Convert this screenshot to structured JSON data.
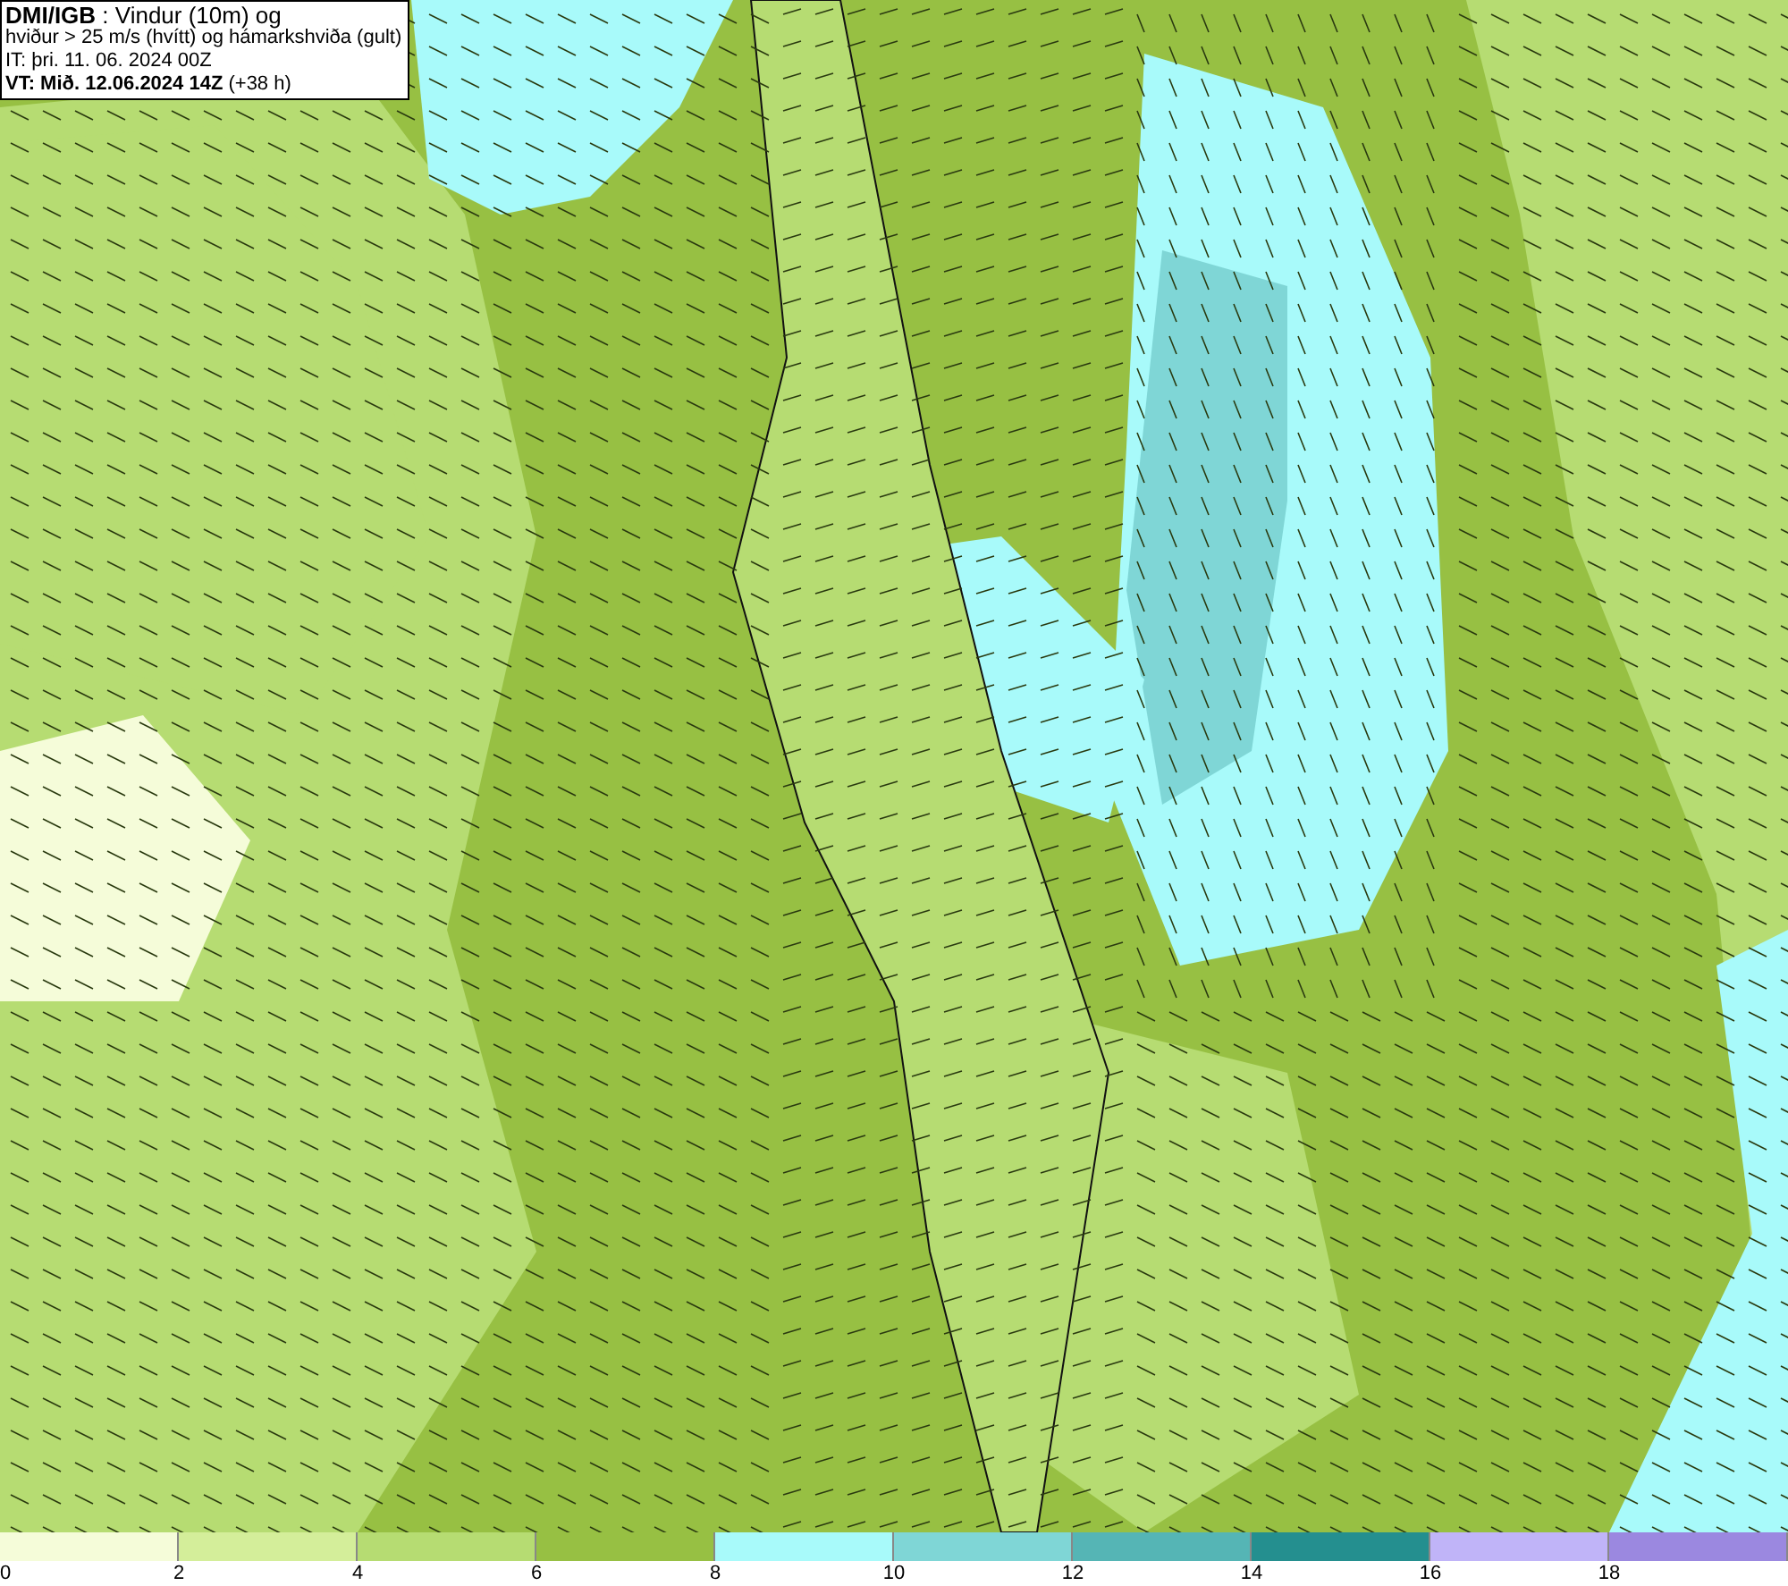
{
  "header": {
    "lines": [
      "**DMI/IGB** : Vindur (10m) og",
      "hviður > 25 m/s (hvítt) og hámarkshviða (gult)",
      "IT: þri. 11. 06. 2024 00Z",
      "**VT: Mið. 12.06.2024 14Z** (+38 h)"
    ]
  },
  "legend": {
    "bins": [
      {
        "label": "0",
        "color": "#f5fcd9"
      },
      {
        "label": "2",
        "color": "#d4ee9a"
      },
      {
        "label": "4",
        "color": "#b6dc72"
      },
      {
        "label": "6",
        "color": "#97c043"
      },
      {
        "label": "8",
        "color": "#a8fafa"
      },
      {
        "label": "10",
        "color": "#7fd6d6"
      },
      {
        "label": "12",
        "color": "#55b5b5"
      },
      {
        "label": "14",
        "color": "#248f8f"
      },
      {
        "label": "16",
        "color": "#c0b4f8"
      },
      {
        "label": "18",
        "color": "#9b88e0"
      }
    ]
  }
}
